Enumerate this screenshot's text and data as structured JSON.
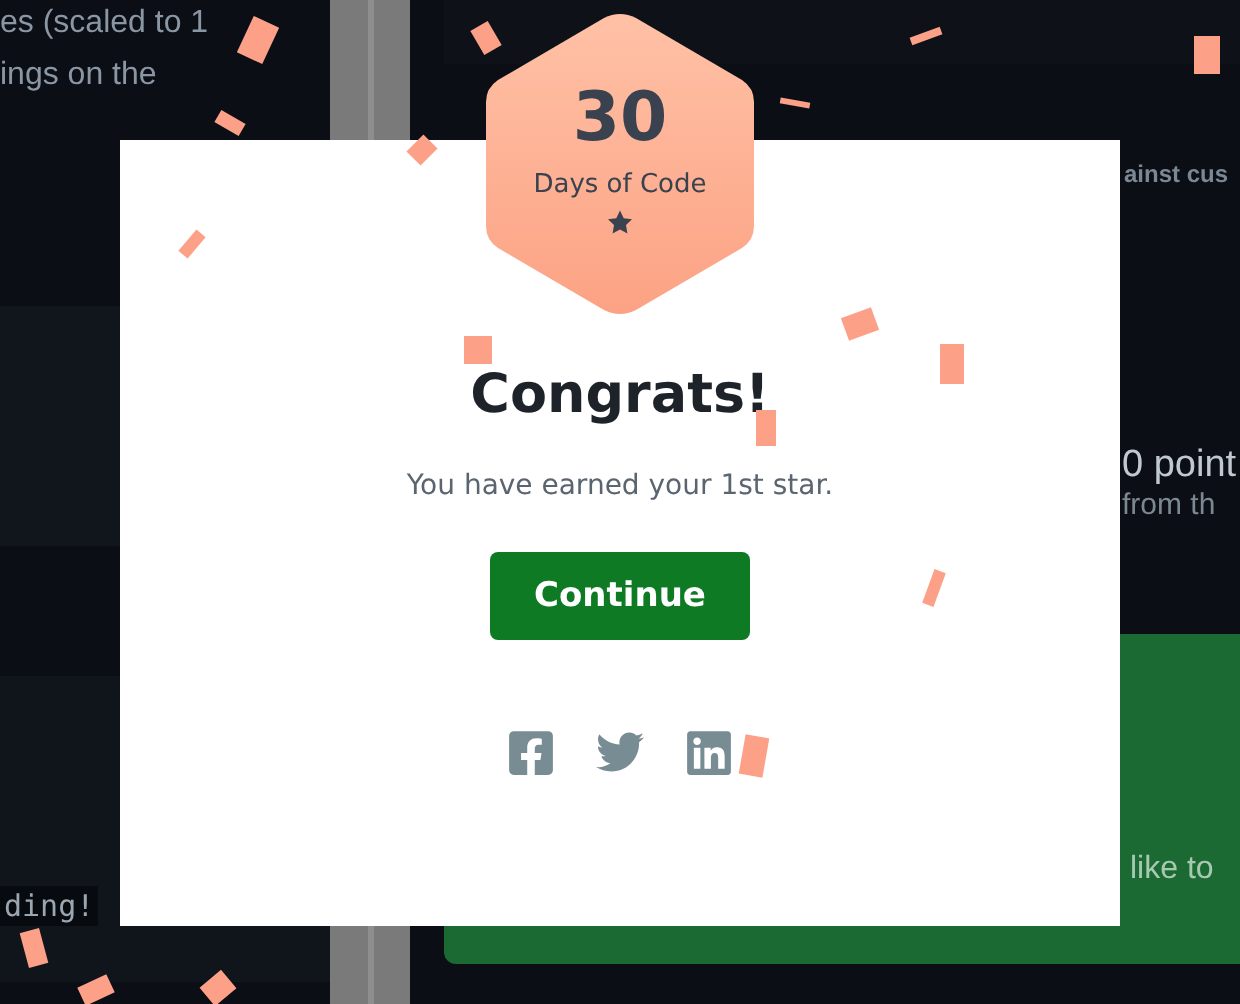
{
  "background": {
    "left_texts": [
      "es (scaled to 1",
      "ings on the"
    ],
    "code_snippet": "ding!",
    "right_heading": "ainst cus",
    "points": "0 point",
    "points_note": "from th",
    "banner_text": "like to"
  },
  "modal": {
    "badge": {
      "number": "30",
      "label": "Days of Code"
    },
    "title": "Congrats!",
    "message": "You have earned your 1st star.",
    "button": "Continue",
    "share_links": [
      {
        "kind": "facebook"
      },
      {
        "kind": "twitter"
      },
      {
        "kind": "linkedin"
      }
    ]
  }
}
